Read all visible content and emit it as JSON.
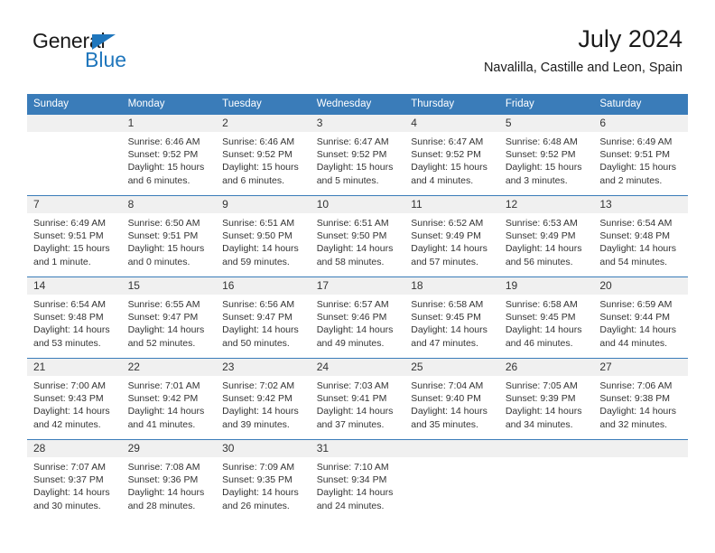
{
  "brand": {
    "name_dark": "General",
    "name_blue": "Blue",
    "accent_color": "#1f76bc"
  },
  "header": {
    "title": "July 2024",
    "location": "Navalilla, Castille and Leon, Spain",
    "header_bg_color": "#3a7cb9",
    "daynum_band_color": "#f0f0f0"
  },
  "weekday_headers": [
    "Sunday",
    "Monday",
    "Tuesday",
    "Wednesday",
    "Thursday",
    "Friday",
    "Saturday"
  ],
  "calendar": {
    "weeks": [
      [
        {
          "day": "",
          "sunrise": "",
          "sunset": "",
          "daylight": "",
          "empty": true
        },
        {
          "day": "1",
          "sunrise": "Sunrise: 6:46 AM",
          "sunset": "Sunset: 9:52 PM",
          "daylight": "Daylight: 15 hours and 6 minutes."
        },
        {
          "day": "2",
          "sunrise": "Sunrise: 6:46 AM",
          "sunset": "Sunset: 9:52 PM",
          "daylight": "Daylight: 15 hours and 6 minutes."
        },
        {
          "day": "3",
          "sunrise": "Sunrise: 6:47 AM",
          "sunset": "Sunset: 9:52 PM",
          "daylight": "Daylight: 15 hours and 5 minutes."
        },
        {
          "day": "4",
          "sunrise": "Sunrise: 6:47 AM",
          "sunset": "Sunset: 9:52 PM",
          "daylight": "Daylight: 15 hours and 4 minutes."
        },
        {
          "day": "5",
          "sunrise": "Sunrise: 6:48 AM",
          "sunset": "Sunset: 9:52 PM",
          "daylight": "Daylight: 15 hours and 3 minutes."
        },
        {
          "day": "6",
          "sunrise": "Sunrise: 6:49 AM",
          "sunset": "Sunset: 9:51 PM",
          "daylight": "Daylight: 15 hours and 2 minutes."
        }
      ],
      [
        {
          "day": "7",
          "sunrise": "Sunrise: 6:49 AM",
          "sunset": "Sunset: 9:51 PM",
          "daylight": "Daylight: 15 hours and 1 minute."
        },
        {
          "day": "8",
          "sunrise": "Sunrise: 6:50 AM",
          "sunset": "Sunset: 9:51 PM",
          "daylight": "Daylight: 15 hours and 0 minutes."
        },
        {
          "day": "9",
          "sunrise": "Sunrise: 6:51 AM",
          "sunset": "Sunset: 9:50 PM",
          "daylight": "Daylight: 14 hours and 59 minutes."
        },
        {
          "day": "10",
          "sunrise": "Sunrise: 6:51 AM",
          "sunset": "Sunset: 9:50 PM",
          "daylight": "Daylight: 14 hours and 58 minutes."
        },
        {
          "day": "11",
          "sunrise": "Sunrise: 6:52 AM",
          "sunset": "Sunset: 9:49 PM",
          "daylight": "Daylight: 14 hours and 57 minutes."
        },
        {
          "day": "12",
          "sunrise": "Sunrise: 6:53 AM",
          "sunset": "Sunset: 9:49 PM",
          "daylight": "Daylight: 14 hours and 56 minutes."
        },
        {
          "day": "13",
          "sunrise": "Sunrise: 6:54 AM",
          "sunset": "Sunset: 9:48 PM",
          "daylight": "Daylight: 14 hours and 54 minutes."
        }
      ],
      [
        {
          "day": "14",
          "sunrise": "Sunrise: 6:54 AM",
          "sunset": "Sunset: 9:48 PM",
          "daylight": "Daylight: 14 hours and 53 minutes."
        },
        {
          "day": "15",
          "sunrise": "Sunrise: 6:55 AM",
          "sunset": "Sunset: 9:47 PM",
          "daylight": "Daylight: 14 hours and 52 minutes."
        },
        {
          "day": "16",
          "sunrise": "Sunrise: 6:56 AM",
          "sunset": "Sunset: 9:47 PM",
          "daylight": "Daylight: 14 hours and 50 minutes."
        },
        {
          "day": "17",
          "sunrise": "Sunrise: 6:57 AM",
          "sunset": "Sunset: 9:46 PM",
          "daylight": "Daylight: 14 hours and 49 minutes."
        },
        {
          "day": "18",
          "sunrise": "Sunrise: 6:58 AM",
          "sunset": "Sunset: 9:45 PM",
          "daylight": "Daylight: 14 hours and 47 minutes."
        },
        {
          "day": "19",
          "sunrise": "Sunrise: 6:58 AM",
          "sunset": "Sunset: 9:45 PM",
          "daylight": "Daylight: 14 hours and 46 minutes."
        },
        {
          "day": "20",
          "sunrise": "Sunrise: 6:59 AM",
          "sunset": "Sunset: 9:44 PM",
          "daylight": "Daylight: 14 hours and 44 minutes."
        }
      ],
      [
        {
          "day": "21",
          "sunrise": "Sunrise: 7:00 AM",
          "sunset": "Sunset: 9:43 PM",
          "daylight": "Daylight: 14 hours and 42 minutes."
        },
        {
          "day": "22",
          "sunrise": "Sunrise: 7:01 AM",
          "sunset": "Sunset: 9:42 PM",
          "daylight": "Daylight: 14 hours and 41 minutes."
        },
        {
          "day": "23",
          "sunrise": "Sunrise: 7:02 AM",
          "sunset": "Sunset: 9:42 PM",
          "daylight": "Daylight: 14 hours and 39 minutes."
        },
        {
          "day": "24",
          "sunrise": "Sunrise: 7:03 AM",
          "sunset": "Sunset: 9:41 PM",
          "daylight": "Daylight: 14 hours and 37 minutes."
        },
        {
          "day": "25",
          "sunrise": "Sunrise: 7:04 AM",
          "sunset": "Sunset: 9:40 PM",
          "daylight": "Daylight: 14 hours and 35 minutes."
        },
        {
          "day": "26",
          "sunrise": "Sunrise: 7:05 AM",
          "sunset": "Sunset: 9:39 PM",
          "daylight": "Daylight: 14 hours and 34 minutes."
        },
        {
          "day": "27",
          "sunrise": "Sunrise: 7:06 AM",
          "sunset": "Sunset: 9:38 PM",
          "daylight": "Daylight: 14 hours and 32 minutes."
        }
      ],
      [
        {
          "day": "28",
          "sunrise": "Sunrise: 7:07 AM",
          "sunset": "Sunset: 9:37 PM",
          "daylight": "Daylight: 14 hours and 30 minutes."
        },
        {
          "day": "29",
          "sunrise": "Sunrise: 7:08 AM",
          "sunset": "Sunset: 9:36 PM",
          "daylight": "Daylight: 14 hours and 28 minutes."
        },
        {
          "day": "30",
          "sunrise": "Sunrise: 7:09 AM",
          "sunset": "Sunset: 9:35 PM",
          "daylight": "Daylight: 14 hours and 26 minutes."
        },
        {
          "day": "31",
          "sunrise": "Sunrise: 7:10 AM",
          "sunset": "Sunset: 9:34 PM",
          "daylight": "Daylight: 14 hours and 24 minutes."
        },
        {
          "day": "",
          "sunrise": "",
          "sunset": "",
          "daylight": "",
          "empty": true
        },
        {
          "day": "",
          "sunrise": "",
          "sunset": "",
          "daylight": "",
          "empty": true
        },
        {
          "day": "",
          "sunrise": "",
          "sunset": "",
          "daylight": "",
          "empty": true
        }
      ]
    ]
  }
}
